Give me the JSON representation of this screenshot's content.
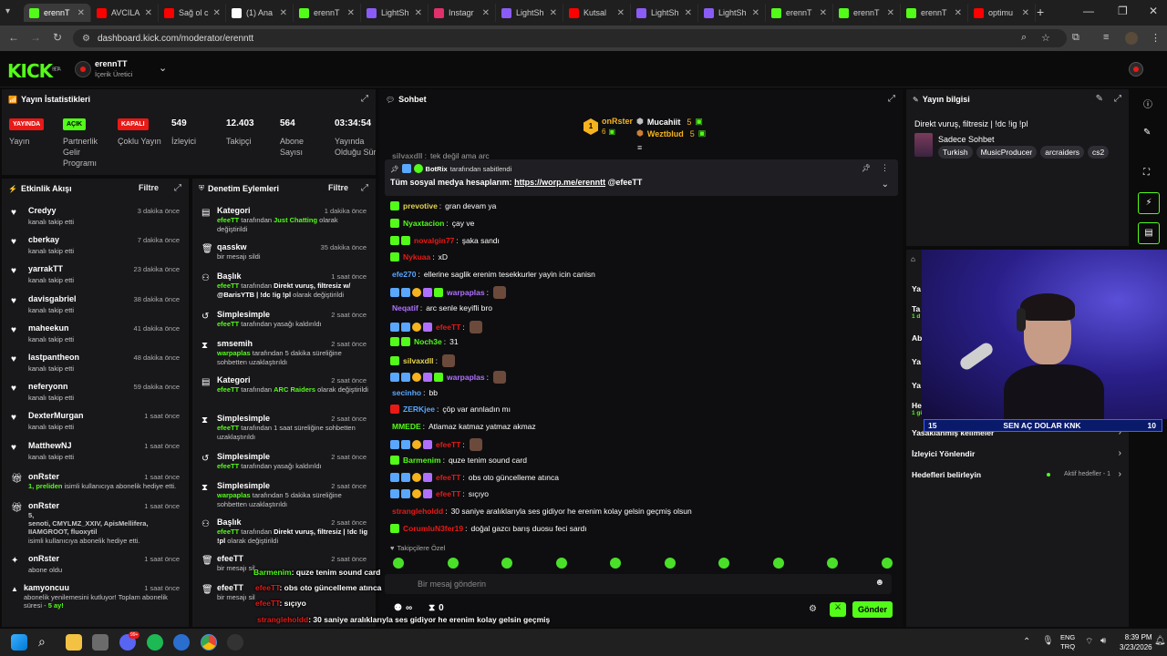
{
  "tabs": [
    {
      "label": "erennT",
      "color": "#53fc18",
      "active": true
    },
    {
      "label": "AVCILA",
      "color": "#ff0000"
    },
    {
      "label": "Sağ ol c",
      "color": "#ff0000"
    },
    {
      "label": "(1) Ana",
      "color": "#ffffff"
    },
    {
      "label": "erennT",
      "color": "#53fc18"
    },
    {
      "label": "LightSh",
      "color": "#8a5cf5"
    },
    {
      "label": "Instagr",
      "color": "#e1306c"
    },
    {
      "label": "LightSh",
      "color": "#8a5cf5"
    },
    {
      "label": "Kutsal",
      "color": "#ff0000"
    },
    {
      "label": "LightSh",
      "color": "#8a5cf5"
    },
    {
      "label": "LightSh",
      "color": "#8a5cf5"
    },
    {
      "label": "erennT",
      "color": "#53fc18"
    },
    {
      "label": "erennT",
      "color": "#53fc18"
    },
    {
      "label": "erennT",
      "color": "#53fc18"
    },
    {
      "label": "optimu",
      "color": "#ff0000"
    }
  ],
  "address": {
    "url": "dashboard.kick.com/moderator/erenntt"
  },
  "header": {
    "logo": "KICK",
    "beta": "BETA",
    "channel_name": "erennTT",
    "channel_role": "İçerik Üretici"
  },
  "stats": {
    "title": "Yayın İstatistikleri",
    "badges": [
      {
        "badge": "YAYINDA",
        "label": "Yayın",
        "color": "#e91916"
      },
      {
        "badge": "AÇIK",
        "label": "Partnerlik Gelir Programı",
        "color": "#53fc18"
      },
      {
        "badge": "KAPALI",
        "label": "Çoklu Yayın",
        "color": "#e91916"
      }
    ],
    "numbers": [
      {
        "value": "549",
        "label": "İzleyici"
      },
      {
        "value": "12.403",
        "label": "Takipçi"
      },
      {
        "value": "564",
        "label": "Abone Sayısı"
      },
      {
        "value": "03:34:54",
        "label": "Yayında Olduğu Süre"
      }
    ]
  },
  "activity": {
    "title": "Etkinlik Akışı",
    "filter": "Filtre",
    "items": [
      {
        "name": "Credyy",
        "sub": "kanalı takip etti",
        "time": "3 dakika önce",
        "icon": "heart"
      },
      {
        "name": "cberkay",
        "sub": "kanalı takip etti",
        "time": "7 dakika önce",
        "icon": "heart"
      },
      {
        "name": "yarrakTT",
        "sub": "kanalı takip etti",
        "time": "23 dakika önce",
        "icon": "heart"
      },
      {
        "name": "davisgabriel",
        "sub": "kanalı takip etti",
        "time": "38 dakika önce",
        "icon": "heart"
      },
      {
        "name": "maheekun",
        "sub": "kanalı takip etti",
        "time": "41 dakika önce",
        "icon": "heart"
      },
      {
        "name": "lastpantheon",
        "sub": "kanalı takip etti",
        "time": "48 dakika önce",
        "icon": "heart"
      },
      {
        "name": "neferyonn",
        "sub": "kanalı takip etti",
        "time": "59 dakika önce",
        "icon": "heart"
      },
      {
        "name": "DexterMurgan",
        "sub": "kanalı takip etti",
        "time": "1 saat önce",
        "icon": "heart"
      },
      {
        "name": "MatthewNJ",
        "sub": "kanalı takip etti",
        "time": "1 saat önce",
        "icon": "heart"
      }
    ],
    "gift1": {
      "name": "onRster",
      "time": "1 saat önce",
      "highlight": "1, preliden",
      "sub": "isimli kullanıcıya abonelik hediye etti."
    },
    "gift2": {
      "name": "onRster",
      "time": "1 saat önce",
      "count": "5,",
      "users": "senoti, CMYLMZ_XXIV, ApisMellifera, IIAMGROOT, fluoxytil",
      "sub": "isimli kullanıcıya abonelik hediye etti."
    },
    "sub1": {
      "name": "onRster",
      "sub": "abone oldu",
      "time": "1 saat önce"
    },
    "resub": {
      "name": "kamyoncuu",
      "sub": "abonelik yenilemesini kutluyor! Toplam abonelik süresi -",
      "months": "5 ay!",
      "time": "1 saat önce"
    }
  },
  "moderation": {
    "title": "Denetim Eylemleri",
    "filter": "Filtre",
    "items": [
      {
        "name": "Kategori",
        "time": "1 dakika önce",
        "icon": "category",
        "lines": [
          [
            "efeeTT",
            "g"
          ],
          [
            " tarafından ",
            ""
          ],
          [
            "Just Chatting",
            "g"
          ],
          [
            " olarak değiştirildi",
            ""
          ]
        ]
      },
      {
        "name": "qasskw",
        "time": "35 dakika önce",
        "icon": "trash",
        "lines": [
          [
            "bir mesajı sildi",
            ""
          ]
        ]
      },
      {
        "name": "Başlık",
        "time": "1 saat önce",
        "icon": "title",
        "lines": [
          [
            "efeeTT",
            "g"
          ],
          [
            " tarafından ",
            ""
          ],
          [
            "Direkt vuruş, filtresiz w/ @BarisYTB | !dc !ig !pl",
            "w"
          ],
          [
            " olarak değiştirildi",
            ""
          ]
        ]
      },
      {
        "name": "Simplesimple",
        "time": "2 saat önce",
        "icon": "undo",
        "lines": [
          [
            "efeeTT",
            "g"
          ],
          [
            " tarafından yasağı kaldırıldı",
            ""
          ]
        ]
      },
      {
        "name": "smsemih",
        "time": "2 saat önce",
        "icon": "timeout",
        "lines": [
          [
            "warpaplas",
            "g"
          ],
          [
            " tarafından 5 dakika süreliğine sohbetten uzaklaştırıldı",
            ""
          ]
        ]
      },
      {
        "name": "Kategori",
        "time": "2 saat önce",
        "icon": "category",
        "lines": [
          [
            "efeeTT",
            "g"
          ],
          [
            " tarafından ",
            ""
          ],
          [
            "ARC Raiders",
            "g"
          ],
          [
            " olarak değiştirildi",
            ""
          ]
        ]
      },
      {
        "name": "Simplesimple",
        "time": "2 saat önce",
        "icon": "timeout",
        "lines": [
          [
            "efeeTT",
            "g"
          ],
          [
            " tarafından 1 saat süreliğine sohbetten uzaklaştırıldı",
            ""
          ]
        ]
      },
      {
        "name": "Simplesimple",
        "time": "2 saat önce",
        "icon": "undo",
        "lines": [
          [
            "efeeTT",
            "g"
          ],
          [
            " tarafından yasağı kaldırıldı",
            ""
          ]
        ]
      },
      {
        "name": "Simplesimple",
        "time": "2 saat önce",
        "icon": "timeout",
        "lines": [
          [
            "warpaplas",
            "g"
          ],
          [
            " tarafından 5 dakika süreliğine sohbetten uzaklaştırıldı",
            ""
          ]
        ]
      },
      {
        "name": "Başlık",
        "time": "2 saat önce",
        "icon": "title",
        "lines": [
          [
            "efeeTT",
            "g"
          ],
          [
            " tarafından ",
            ""
          ],
          [
            "Direkt vuruş, filtresiz | !dc !ig !pl",
            "w"
          ],
          [
            " olarak değiştirildi",
            ""
          ]
        ]
      },
      {
        "name": "efeeTT",
        "time": "2 saat önce",
        "icon": "trash",
        "lines": [
          [
            "bir mesajı sil",
            ""
          ]
        ]
      },
      {
        "name": "efeeTT",
        "time": "",
        "icon": "trash",
        "lines": [
          [
            "bir mesajı sil",
            ""
          ]
        ]
      }
    ]
  },
  "chat": {
    "title": "Sohbet",
    "leaders": [
      {
        "name": "onRster",
        "count": "6",
        "rank": "1"
      },
      {
        "name": "Mucahiit",
        "count": "5"
      },
      {
        "name": "Weztblud",
        "count": "5"
      }
    ],
    "pinned": {
      "by": "BotRix",
      "by_suffix": "tarafından sabitlendi",
      "text": "Tüm sosyal medya hesaplarım:",
      "link": "https://worp.me/erenntt",
      "mention": "@efeeTT"
    },
    "messages": [
      {
        "user": "silvaxdll",
        "color": "#c0c0c0",
        "text": "tek değil ama arc",
        "partial": true
      },
      {
        "user": "prevotive",
        "color": "#e6d44c",
        "text": "gran devam ya",
        "badges": [
          "v"
        ]
      },
      {
        "user": "Nyaxtacion",
        "color": "#53fc18",
        "text": "çay ve",
        "badges": [
          "v"
        ]
      },
      {
        "user": "novalgin77",
        "color": "#e91916",
        "text": "şaka sandı",
        "badges": [
          "v",
          "g"
        ]
      },
      {
        "user": "Nykuaa",
        "color": "#e91916",
        "text": "xD",
        "badges": [
          "v"
        ]
      },
      {
        "user": "efe270",
        "color": "#5aa7ff",
        "text": "ellerine saglik erenim tesekkurler yayin icin canisn",
        "badges": []
      },
      {
        "user": "warpaplas",
        "color": "#b070ff",
        "text": "",
        "emote": true,
        "badges": [
          "b",
          "b",
          "o",
          "p",
          "g"
        ]
      },
      {
        "user": "Neqatif",
        "color": "#b070ff",
        "text": "arc senle keyifli bro",
        "badges": []
      },
      {
        "user": "efeeTT",
        "color": "#e91916",
        "text": "",
        "emote": true,
        "badges": [
          "b",
          "b",
          "o",
          "p"
        ]
      },
      {
        "user": "Noch3e",
        "color": "#53fc18",
        "text": "31",
        "badges": [
          "v",
          "g"
        ]
      },
      {
        "user": "silvaxdll",
        "color": "#e6d44c",
        "text": "",
        "emote": true,
        "badges": [
          "v"
        ]
      },
      {
        "user": "warpaplas",
        "color": "#b070ff",
        "text": "",
        "emote": true,
        "badges": [
          "b",
          "b",
          "o",
          "p",
          "g"
        ]
      },
      {
        "user": "secinho",
        "color": "#5aa7ff",
        "text": "bb",
        "badges": []
      },
      {
        "user": "ZERKjee",
        "color": "#5aa7ff",
        "text": "çöp var annladın mı",
        "badges": [
          "r"
        ]
      },
      {
        "user": "MMEDE",
        "color": "#53fc18",
        "text": "Atlamaz katmaz yatmaz akmaz",
        "badges": []
      },
      {
        "user": "efeeTT",
        "color": "#e91916",
        "text": "",
        "emote": true,
        "badges": [
          "b",
          "b",
          "o",
          "p"
        ]
      },
      {
        "user": "Barmenim",
        "color": "#53fc18",
        "text": "quze tenim sound card",
        "badges": [
          "v"
        ]
      },
      {
        "user": "efeeTT",
        "color": "#e91916",
        "text": "obs oto güncelleme atınca",
        "badges": [
          "b",
          "b",
          "o",
          "p"
        ]
      },
      {
        "user": "efeeTT",
        "color": "#e91916",
        "text": "sıçıyo",
        "badges": [
          "b",
          "b",
          "o",
          "p"
        ]
      },
      {
        "user": "strangleholdd",
        "color": "#e91916",
        "text": "30 saniye aralıklarıyla ses gidiyor he erenim kolay gelsin geçmiş olsun",
        "badges": []
      },
      {
        "user": "CorumluN3fer19",
        "color": "#e91916",
        "text": "doğal gazcı barış duosu feci sardı",
        "badges": [
          "v"
        ]
      }
    ],
    "emote_label": "Takipçilere Özel",
    "input_placeholder": "Bir mesaj gönderin",
    "send": "Gönder",
    "footer_infinity": "∞",
    "footer_count": "0"
  },
  "stream_info": {
    "title": "Yayın bilgisi",
    "stream_title": "Direkt vuruş, filtresiz | !dc !ig !pl",
    "category": "Sadece Sohbet",
    "tags": [
      "Turkish",
      "MusicProducer",
      "arcraiders",
      "cs2"
    ],
    "partial_rows": [
      "Ya",
      "Ta",
      "1 d",
      "Ab",
      "Ya",
      "Ya",
      "He",
      "1 gün"
    ],
    "rows": [
      {
        "label": "Yasaklanmış kelimeler"
      },
      {
        "label": "İzleyici Yönlendir"
      },
      {
        "label": "Hedefleri belirleyin",
        "status": "Aktif hedefler - 1"
      }
    ]
  },
  "overlay": {
    "goal_left": "15",
    "goal_text": "SEN AÇ DOLAR KNK",
    "goal_right": "10",
    "captions": [
      {
        "user": "Barmenim",
        "text": ": quze tenim sound card",
        "color": "#53fc18"
      },
      {
        "user": "efeeTT",
        "text": ": obs oto güncelleme atınca",
        "color": "#e91916"
      },
      {
        "user": "efeeTT",
        "text": ": sıçıyo",
        "color": "#e91916"
      },
      {
        "user": "strangleholdd",
        "text": ": 30 saniye aralıklarıyla ses gidiyor he erenim kolay gelsin geçmiş",
        "color": "#e91916"
      },
      {
        "user": "",
        "text": "olsun",
        "color": "#fff"
      },
      {
        "user": "CorumluN3fer19",
        "text": ": doğal gazcı barış duosu feci sardı",
        "color": "#e91916"
      }
    ]
  },
  "taskbar": {
    "lang1": "ENG",
    "lang2": "TRQ",
    "time": "8:39 PM",
    "date": "3/23/2026",
    "notif": "99+"
  }
}
